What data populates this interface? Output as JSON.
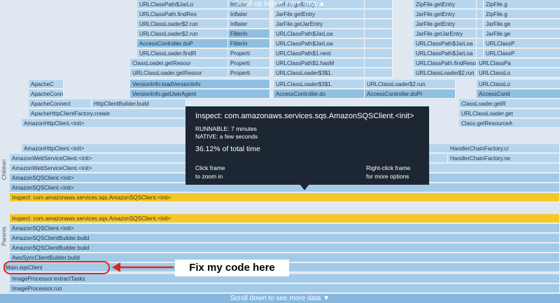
{
  "banners": {
    "top": "Scroll up to see more data",
    "bottom": "Scroll down to see more data"
  },
  "rails": {
    "children": "Children",
    "parents": "Parents"
  },
  "rows": [
    [
      {
        "t": "URLClassPath$JarLo",
        "c": "c2"
      },
      {
        "t": "Inflater",
        "c": "c2"
      },
      {
        "t": "JarFile.getEntry",
        "c": "c2"
      },
      {
        "t": "",
        "c": "c2"
      },
      {
        "t": "ZipFile.getEntry",
        "c": "c2"
      },
      {
        "t": "",
        "c": "c2"
      },
      {
        "t": "ZipFile.g",
        "c": "c2"
      }
    ],
    [
      {
        "t": "URLClassPath.findRes",
        "c": "c2"
      },
      {
        "t": "Inflater",
        "c": "c2"
      },
      {
        "t": "JarFile.getEntry",
        "c": "c2"
      },
      {
        "t": "",
        "c": "c2"
      },
      {
        "t": "JarFile.getEntry",
        "c": "c2"
      },
      {
        "t": "",
        "c": "c2"
      },
      {
        "t": "ZipFile.g",
        "c": "c2"
      }
    ],
    [
      {
        "t": "URLClassLoader$2.run",
        "c": "c2"
      },
      {
        "t": "Inflater",
        "c": "c2"
      },
      {
        "t": "JarFile.getJarEntry",
        "c": "c2"
      },
      {
        "t": "",
        "c": "c2"
      },
      {
        "t": "JarFile.getEntry",
        "c": "c2"
      },
      {
        "t": "",
        "c": "c2"
      },
      {
        "t": "JarFile.ge",
        "c": "c2"
      }
    ],
    [
      {
        "t": "URLClassLoader$2.run",
        "c": "c2"
      },
      {
        "t": "FilterIn",
        "c": "c1"
      },
      {
        "t": "URLClassPath$JarLoa",
        "c": "c2"
      },
      {
        "t": "",
        "c": "c2"
      },
      {
        "t": "JarFile.getJarEntry",
        "c": "c2"
      },
      {
        "t": "",
        "c": "c2"
      },
      {
        "t": "JarFile.ge",
        "c": "c2"
      }
    ],
    [
      {
        "t": "AccessController.doP",
        "c": "c1"
      },
      {
        "t": "FilterIn",
        "c": "c1"
      },
      {
        "t": "URLClassPath$JarLoa",
        "c": "c2"
      },
      {
        "t": "",
        "c": "c2"
      },
      {
        "t": "URLClassPath$JarLoa",
        "c": "c2"
      },
      {
        "t": "",
        "c": "c2"
      },
      {
        "t": "URLClassP",
        "c": "c2"
      }
    ],
    [
      {
        "t": "URLClassLoader.findR",
        "c": "c2"
      },
      {
        "t": "Properti",
        "c": "c2"
      },
      {
        "t": "URLClassPath$1.next",
        "c": "c2"
      },
      {
        "t": "",
        "c": "c2"
      },
      {
        "t": "URLClassPath$JarLoa",
        "c": "c2"
      },
      {
        "t": "",
        "c": "c2"
      },
      {
        "t": "URLClassP",
        "c": "c2"
      }
    ],
    [
      {
        "t": "ClassLoader.getResour",
        "c": "c2"
      },
      {
        "t": "Properti",
        "c": "c2"
      },
      {
        "t": "URLClassPath$1.hasM",
        "c": "c2"
      },
      {
        "t": "",
        "c": "c2"
      },
      {
        "t": "URLClassPath.findReso",
        "c": "c2"
      },
      {
        "t": "URLClassPa",
        "c": "c2"
      }
    ],
    [
      {
        "t": "URLClassLoader.getResour",
        "c": "c2"
      },
      {
        "t": "Properti",
        "c": "c2"
      },
      {
        "t": "URLClassLoader$3$1.",
        "c": "c2"
      },
      {
        "t": "",
        "c": "c2"
      },
      {
        "t": "URLClassLoader$2.run",
        "c": "c2"
      },
      {
        "t": "URLClassLo",
        "c": "c2"
      }
    ],
    [
      {
        "t": "ApacheC",
        "c": "c2"
      },
      {
        "t": "VersionInfo.loadVersionInfo",
        "c": "c1"
      },
      {
        "t": "URLClassLoader$3$1.",
        "c": "c2"
      },
      {
        "t": "URLClassLoader$2.run",
        "c": "c2"
      },
      {
        "t": "URLClassLo",
        "c": "c2"
      }
    ],
    [
      {
        "t": "ApacheConnect",
        "c": "c2"
      },
      {
        "t": "VersionInfo.getUserAgent",
        "c": "c1"
      },
      {
        "t": "AccessController.do",
        "c": "c1"
      },
      {
        "t": "AccessController.doPr",
        "c": "c1"
      },
      {
        "t": "AccessContr",
        "c": "c1"
      }
    ],
    [
      {
        "t": "ApacheConnect",
        "c": "c2"
      },
      {
        "t": "HttpClientBuilder.build",
        "c": "c2"
      },
      {
        "t": "ClassLoader.getR",
        "c": "c2"
      }
    ],
    [
      {
        "t": "ApacheHttpClientFactory.create",
        "c": "c2"
      },
      {
        "t": "URLClassLoader.get",
        "c": "c2"
      }
    ],
    [
      {
        "t": "AmazonHttpClient.<init>",
        "c": "c2"
      },
      {
        "t": "Class.getResourceA",
        "c": "c2"
      }
    ],
    [
      {
        "t": "AmazonHttpClient.<init>",
        "c": "c2"
      },
      {
        "t": "CollectionList",
        "c": "c2"
      },
      {
        "t": "HandlerChainFactory.cr",
        "c": "c2"
      }
    ],
    [
      {
        "t": "AmazonWebServiceClient.<init>",
        "c": "c2"
      },
      {
        "t": "HandlerChainFactory.ne",
        "c": "c2"
      }
    ],
    [
      {
        "t": "AmazonWebServiceClient.<init>",
        "c": "c2"
      }
    ],
    [
      {
        "t": "AmazonSQSClient.<init>",
        "c": "c4"
      }
    ],
    [
      {
        "t": "AmazonSQSClient.<init>",
        "c": "c4"
      }
    ],
    [
      {
        "t": "Inspect: com.amazonaws.services.sqs.AmazonSQSClient.<init>",
        "c": "inspect"
      }
    ],
    [
      {
        "t": "Inspect: com.amazonaws.services.sqs.AmazonSQSClient.<init>",
        "c": "inspect"
      }
    ],
    [
      {
        "t": "AmazonSQSClient.<init>",
        "c": "c4"
      }
    ],
    [
      {
        "t": "AmazonSQSClientBuilder.build",
        "c": "c4"
      }
    ],
    [
      {
        "t": "AmazonSQSClientBuilder.build",
        "c": "c4"
      }
    ],
    [
      {
        "t": "AwsSyncClientBuilder.build",
        "c": "c4"
      }
    ],
    [
      {
        "t": "Main.sqsClient",
        "c": "c4"
      }
    ],
    [
      {
        "t": "ImageProcessor.extractTasks",
        "c": "c4"
      }
    ],
    [
      {
        "t": "ImageProcessor.run",
        "c": "c4"
      }
    ],
    [
      {
        "t": "Main$Lambda.run",
        "c": "c4"
      }
    ]
  ],
  "tooltip": {
    "title": "Inspect: com.amazonaws.services.sqs.AmazonSQSClient.<init>",
    "runnable": "RUNNABLE: 7 minutes",
    "native": "NATIVE: a few seconds",
    "percent": "36.12% of total time",
    "hint_left_1": "Click frame",
    "hint_left_2": "to zoom in",
    "hint_right_1": "Right-click frame",
    "hint_right_2": "for more options"
  },
  "callout": {
    "text": "Fix my code here"
  },
  "colors": {
    "accent": "#f5c827",
    "tooltip_bg": "#1d2733",
    "callout": "#e0261e"
  }
}
